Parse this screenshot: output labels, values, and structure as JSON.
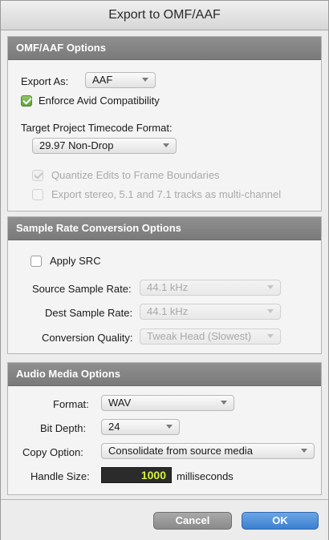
{
  "window": {
    "title": "Export to OMF/AAF"
  },
  "omf_options": {
    "header": "OMF/AAF Options",
    "export_as_label": "Export As:",
    "export_as_value": "AAF",
    "enforce_avid_label": "Enforce Avid Compatibility",
    "enforce_avid_checked": true,
    "timecode_format_label": "Target Project Timecode Format:",
    "timecode_format_value": "29.97 Non-Drop",
    "quantize_label": "Quantize Edits to Frame Boundaries",
    "quantize_checked": true,
    "quantize_enabled": false,
    "multichannel_label": "Export stereo, 5.1 and 7.1 tracks as multi-channel",
    "multichannel_checked": false,
    "multichannel_enabled": false
  },
  "src_options": {
    "header": "Sample Rate Conversion Options",
    "apply_src_label": "Apply SRC",
    "apply_src_checked": false,
    "source_rate_label": "Source Sample Rate:",
    "source_rate_value": "44.1 kHz",
    "dest_rate_label": "Dest Sample Rate:",
    "dest_rate_value": "44.1 kHz",
    "quality_label": "Conversion Quality:",
    "quality_value": "Tweak Head (Slowest)"
  },
  "audio_options": {
    "header": "Audio Media Options",
    "format_label": "Format:",
    "format_value": "WAV",
    "bit_depth_label": "Bit Depth:",
    "bit_depth_value": "24",
    "copy_option_label": "Copy Option:",
    "copy_option_value": "Consolidate from source media",
    "handle_size_label": "Handle Size:",
    "handle_size_value": "1000",
    "handle_size_unit": "milliseconds"
  },
  "buttons": {
    "cancel": "Cancel",
    "ok": "OK"
  },
  "colors": {
    "checkbox_accent": "#5fa238",
    "ok_button": "#3b7fd0",
    "numeric_readout": "#d7f23a"
  }
}
